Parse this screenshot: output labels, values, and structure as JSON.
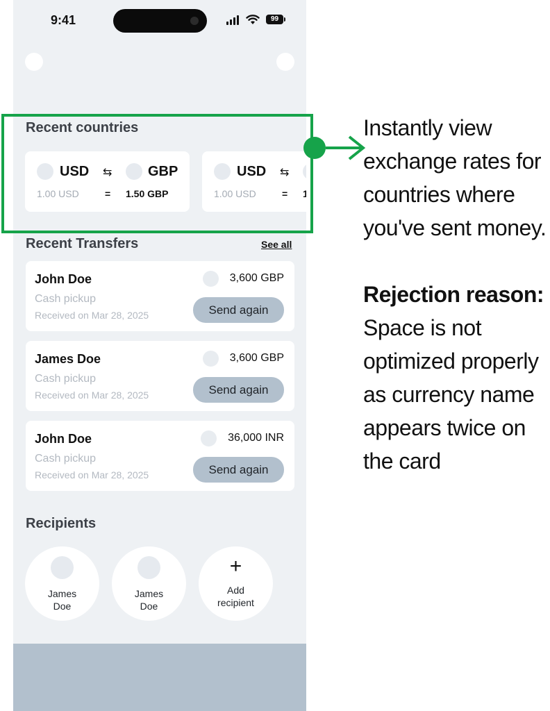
{
  "status_bar": {
    "time": "9:41",
    "battery": "99"
  },
  "recent_countries": {
    "title": "Recent countries",
    "cards": [
      {
        "from": "USD",
        "to": "GBP",
        "swap": "⇆",
        "rate_from": "1.00 USD",
        "eq": "=",
        "rate_to": "1.50 GBP"
      },
      {
        "from": "USD",
        "to": "",
        "swap": "⇆",
        "rate_from": "1.00 USD",
        "eq": "=",
        "rate_to": "1"
      }
    ]
  },
  "recent_transfers": {
    "title": "Recent Transfers",
    "see_all": "See all",
    "items": [
      {
        "name": "John Doe",
        "method": "Cash pickup",
        "date": "Received on Mar 28, 2025",
        "amount": "3,600 GBP",
        "button": "Send again"
      },
      {
        "name": "James Doe",
        "method": "Cash pickup",
        "date": "Received on Mar 28, 2025",
        "amount": "3,600 GBP",
        "button": "Send again"
      },
      {
        "name": "John Doe",
        "method": "Cash pickup",
        "date": "Received on Mar 28, 2025",
        "amount": "36,000 INR",
        "button": "Send again"
      }
    ]
  },
  "recipients": {
    "title": "Recipients",
    "items": [
      {
        "name": "James Doe"
      },
      {
        "name": "James Doe"
      }
    ],
    "add": {
      "icon": "+",
      "label": "Add recipient"
    }
  },
  "annotation": {
    "intro": "Instantly view exchange rates for countries where you've sent money.",
    "rejection_label": "Rejection reason:",
    "rejection_text": "Space is not optimized properly as currency name appears twice on the card"
  },
  "colors": {
    "highlight": "#16a34a",
    "button": "#b2c0cd",
    "background": "#eef1f4"
  }
}
